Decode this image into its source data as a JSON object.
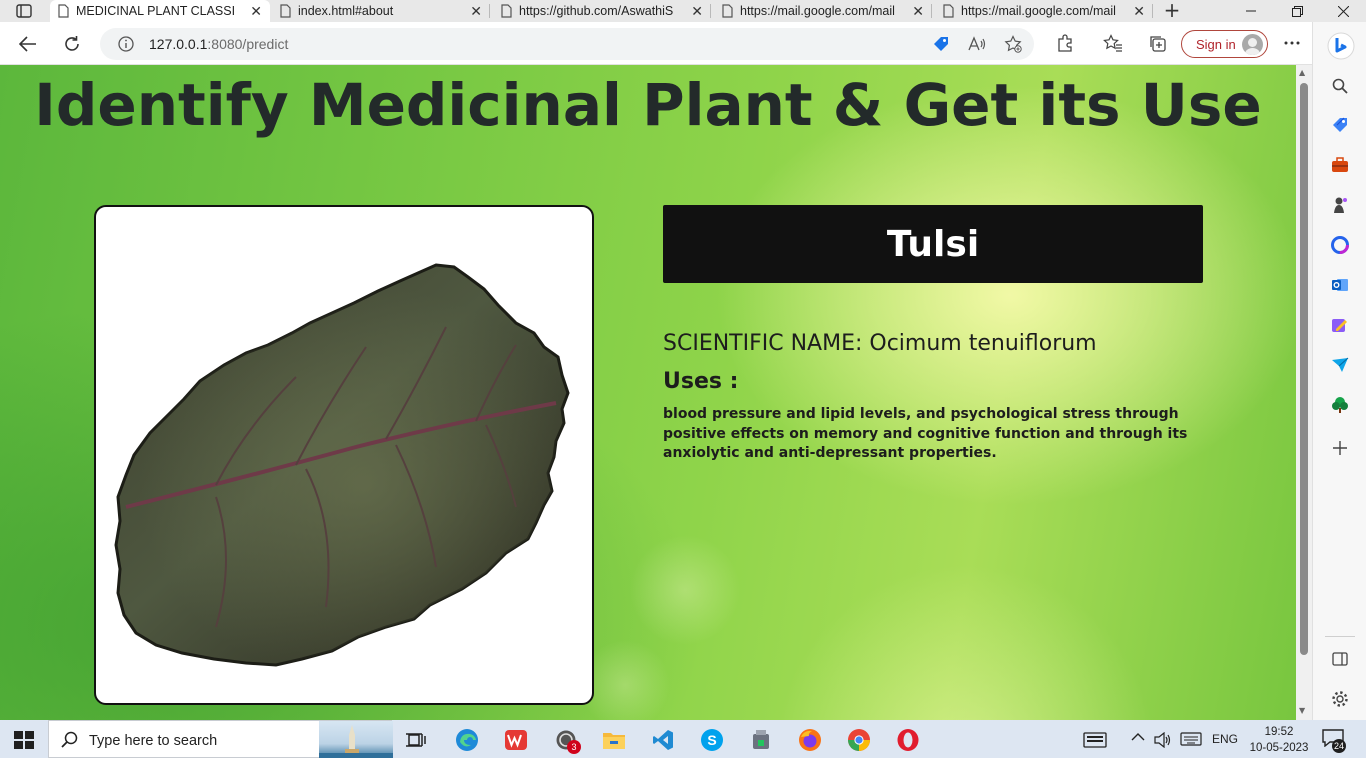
{
  "browser": {
    "tabs": [
      {
        "title": "MEDICINAL PLANT CLASSIFIC",
        "active": true
      },
      {
        "title": "index.html#about",
        "active": false
      },
      {
        "title": "https://github.com/AswathiS",
        "active": false
      },
      {
        "title": "https://mail.google.com/mail",
        "active": false
      },
      {
        "title": "https://mail.google.com/mail",
        "active": false
      }
    ],
    "url_host": "127.0.0.1",
    "url_rest": ":8080/predict",
    "signin_label": "Sign in"
  },
  "page": {
    "title": "Identify Medicinal Plant & Get its Use",
    "plant_name": "Tulsi",
    "scientific_name": "SCIENTIFIC NAME: Ocimum tenuiflorum",
    "uses_heading": "Uses :",
    "uses_text": "blood pressure and lipid levels, and psychological stress through positive effects on memory and cognitive function and through its anxiolytic and anti-depressant properties."
  },
  "taskbar": {
    "search_placeholder": "Type here to search",
    "whatsapp_badge": "3",
    "language": "ENG",
    "time": "19:52",
    "date": "10-05-2023",
    "notifications": "24"
  },
  "colors": {
    "page_green": "#77c843",
    "title_text": "#232a2a",
    "name_box_bg": "#111111",
    "signin_border": "#b0463c"
  }
}
